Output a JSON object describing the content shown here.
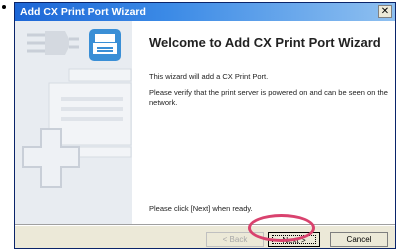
{
  "window": {
    "title": "Add CX Print Port Wizard",
    "close_glyph": "✕"
  },
  "content": {
    "heading": "Welcome to Add CX Print Port Wizard",
    "line1": "This wizard will add a CX Print Port.",
    "line2": "Please verify that the print server is powered on and can be seen on the network.",
    "line3": "Please click [Next] when ready."
  },
  "buttons": {
    "back": "< Back",
    "next": "Next >",
    "cancel": "Cancel"
  },
  "icons": {
    "plug": "plug-icon",
    "printer_port": "printer-port-icon",
    "printer_graphic": "printer-graphic",
    "plus": "plus-graphic"
  },
  "colors": {
    "titlebar": "#1c66d6",
    "highlight": "#d9426e",
    "icon_blue": "#3a8fd6"
  }
}
